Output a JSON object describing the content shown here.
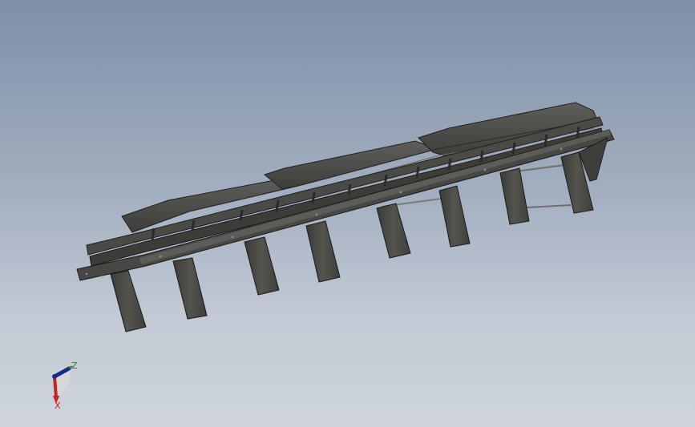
{
  "viewport": {
    "background_top": "#7f8fa6",
    "background_bottom": "#cfd4dc"
  },
  "model": {
    "type": "conveyor-frame-assembly",
    "steel_color": "#4c4c4a",
    "edge_color": "#222222",
    "support_leg_count": 8
  },
  "triad": {
    "z_label": "Z",
    "x_label": "X",
    "z_color": "#2f7a2f",
    "x_color": "#c0261f",
    "y_color": "#1a2a8a"
  }
}
